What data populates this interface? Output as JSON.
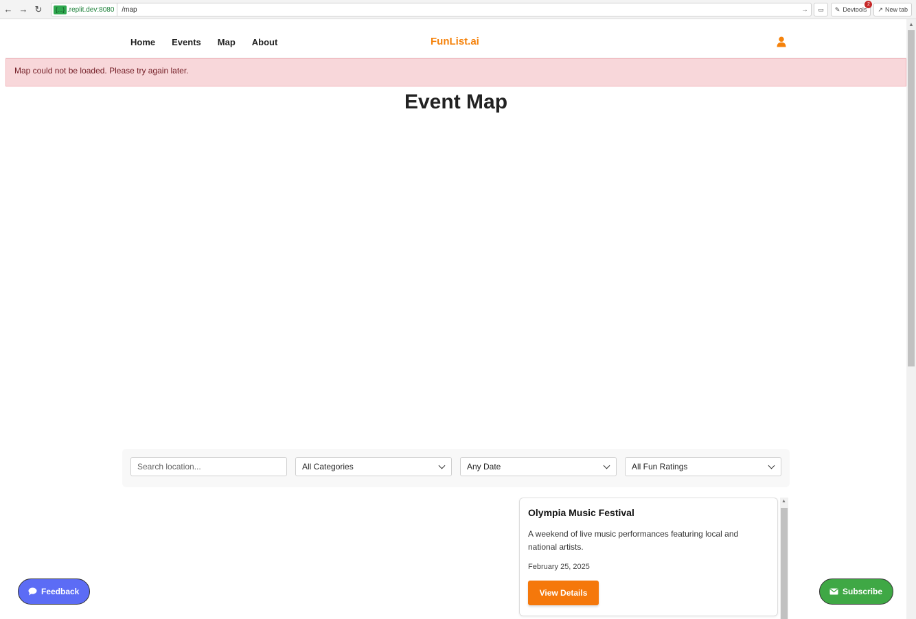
{
  "browser": {
    "url_host": ".replit.dev:8080",
    "url_host_chip": "{...}",
    "url_path": "/map",
    "devtools_label": "Devtools",
    "devtools_badge": "2",
    "new_tab_label": "New tab"
  },
  "header": {
    "nav": [
      "Home",
      "Events",
      "Map",
      "About"
    ],
    "logo": "FunList.ai"
  },
  "alert": {
    "message": "Map could not be loaded. Please try again later."
  },
  "page": {
    "title": "Event Map"
  },
  "filters": {
    "search_placeholder": "Search location...",
    "category": "All Categories",
    "date": "Any Date",
    "rating": "All Fun Ratings"
  },
  "events": [
    {
      "title": "Olympia Music Festival",
      "description": "A weekend of live music performances featuring local and national artists.",
      "date": "February 25, 2025",
      "button": "View Details"
    }
  ],
  "floating": {
    "feedback": "Feedback",
    "subscribe": "Subscribe"
  },
  "colors": {
    "brand": "#f5820b",
    "alert_bg": "#f8d7da",
    "feedback": "#5c6cf5",
    "subscribe": "#3fa845"
  }
}
